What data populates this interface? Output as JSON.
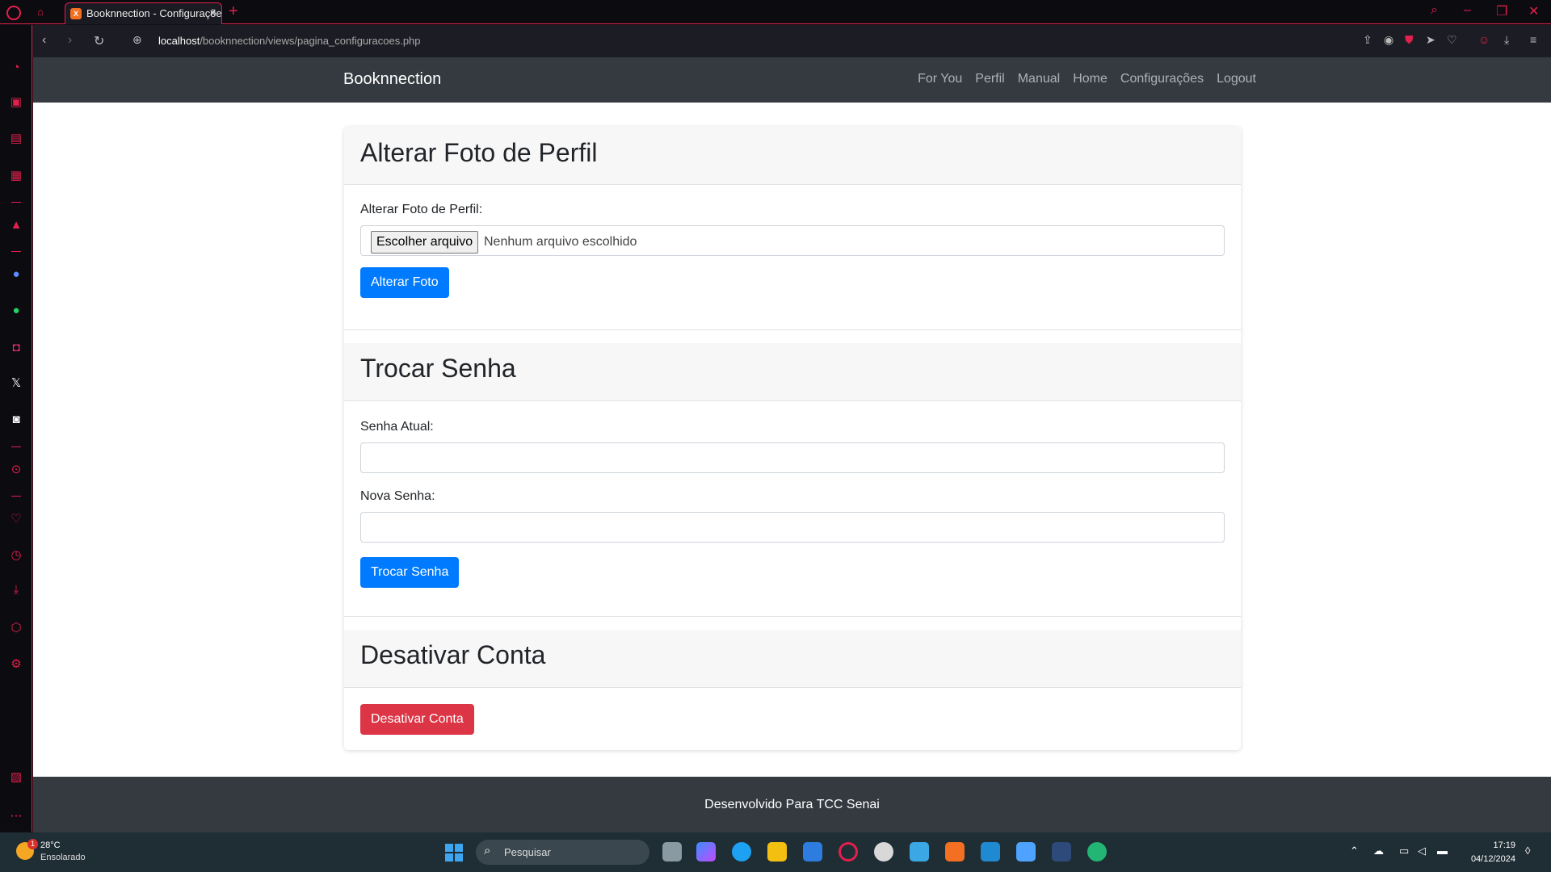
{
  "browser": {
    "tab_title": "Booknnection - Configurações",
    "url_host": "localhost",
    "url_path": "/booknnection/views/pagina_configuracoes.php"
  },
  "navbar": {
    "brand": "Booknnection",
    "links": [
      "For You",
      "Perfil",
      "Manual",
      "Home",
      "Configurações",
      "Logout"
    ]
  },
  "photo_section": {
    "title": "Alterar Foto de Perfil",
    "label": "Alterar Foto de Perfil:",
    "file_button": "Escolher arquivo",
    "file_status": "Nenhum arquivo escolhido",
    "submit": "Alterar Foto"
  },
  "password_section": {
    "title": "Trocar Senha",
    "current_label": "Senha Atual:",
    "new_label": "Nova Senha:",
    "submit": "Trocar Senha"
  },
  "deactivate_section": {
    "title": "Desativar Conta",
    "submit": "Desativar Conta"
  },
  "footer": {
    "text": "Desenvolvido Para TCC Senai"
  },
  "taskbar": {
    "weather_temp": "28°C",
    "weather_desc": "Ensolarado",
    "weather_badge": "1",
    "search_placeholder": "Pesquisar",
    "time": "17:19",
    "date": "04/12/2024"
  },
  "colors": {
    "primary": "#007bff",
    "danger": "#dc3545",
    "navbar": "#343a40",
    "opera_accent": "#e1204d"
  }
}
